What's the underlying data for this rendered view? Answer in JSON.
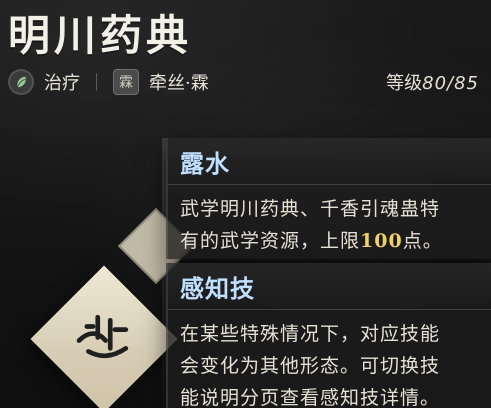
{
  "page": {
    "title": "明川药典"
  },
  "meta": {
    "tag1": "治疗",
    "tag2": "牵丝·霖",
    "seal_char": "霖",
    "level_label": "等级",
    "level_value": "80/85"
  },
  "cards": [
    {
      "title": "露水",
      "lines": [
        "武学明川药典、千香引魂蛊特",
        "有的武学资源，上限",
        "100",
        "点。"
      ]
    },
    {
      "title": "感知技",
      "lines": [
        "在某些特殊情况下，对应技能",
        "会变化为其他形态。可切换技",
        "能说明分页查看感知技详情。"
      ]
    }
  ],
  "colors": {
    "card_title": "#bfe0ff",
    "highlight": "#f2d06a"
  },
  "icons": {
    "tag1": "healing-leaf-icon",
    "tag2": "seal-stamp-icon",
    "skill_tile": "skill-symbol-icon"
  }
}
